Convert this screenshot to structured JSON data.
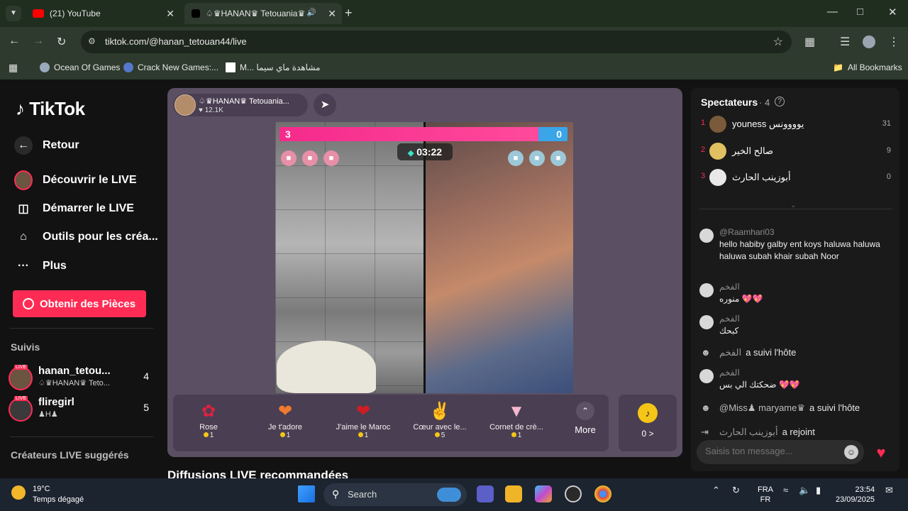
{
  "browser": {
    "tabs": [
      {
        "label": "(21) YouTube",
        "icon": "youtube-icon"
      },
      {
        "label": "♤♛HANAN♛ Tetouania♛",
        "icon": "tiktok-icon"
      }
    ],
    "url": "tiktok.com/@hanan_tetouan44/live",
    "bookmarks": [
      {
        "label": "Ocean Of Games"
      },
      {
        "label": "Crack New Games:..."
      },
      {
        "label": "M... مشاهدة ماي سيما"
      }
    ],
    "all_bookmarks": "All Bookmarks"
  },
  "sidebar": {
    "logo": "TikTok",
    "nav": [
      {
        "label": "Retour",
        "icon": "arrow-left-icon"
      },
      {
        "label": "Découvrir le LIVE",
        "icon": "live-avatar-icon"
      },
      {
        "label": "Démarrer le LIVE",
        "icon": "camera-icon"
      },
      {
        "label": "Outils pour les créa...",
        "icon": "house-tools-icon"
      },
      {
        "label": "Plus",
        "icon": "more-dots-icon"
      }
    ],
    "coins_button": "Obtenir des Pièces",
    "followed_title": "Suivis",
    "followed": [
      {
        "name": "hanan_tetou...",
        "sub": "♤♛HANAN♛ Teto...",
        "count": "4",
        "live_badge": "LIVE"
      },
      {
        "name": "fliregirl",
        "sub": "♟H♟",
        "count": "5",
        "live_badge": "LIVE"
      }
    ],
    "suggested_title": "Créateurs LIVE suggérés"
  },
  "live": {
    "host_name": "♤♛HANAN♛ Tetouania...",
    "host_likes": "12.1K",
    "score_left": "3",
    "score_right": "0",
    "score_fraction": 0.9,
    "timer": "03:22",
    "gifts": [
      {
        "name": "Rose",
        "price": "1",
        "icon": "rose-icon"
      },
      {
        "name": "Je t'adore",
        "price": "1",
        "icon": "heart-hug-icon"
      },
      {
        "name": "J'aime le Maroc",
        "price": "1",
        "icon": "morocco-heart-icon"
      },
      {
        "name": "Cœur avec le...",
        "price": "5",
        "icon": "finger-heart-icon"
      },
      {
        "name": "Cornet de crè...",
        "price": "1",
        "icon": "ice-cream-icon"
      }
    ],
    "more_label": "More",
    "balance": "0 >",
    "recommended_title": "Diffusions LIVE recommandées"
  },
  "chat": {
    "spectators_title": "Spectateurs",
    "spectators_count": "· 4",
    "viewers": [
      {
        "rank": "1",
        "name": "youness يوووونس",
        "score": "31",
        "avatar_color": "#7a5a3a"
      },
      {
        "rank": "2",
        "name": "صالح الخير",
        "score": "9",
        "avatar_color": "#e0c060"
      },
      {
        "rank": "3",
        "name": "أبوزينب الحارث",
        "score": "0",
        "avatar_color": "#e8e8e8"
      }
    ],
    "comments": [
      {
        "user": "@Raamhari03",
        "text": "hello habiby galby ent koys haluwa haluwa haluwa subah khair subah Noor"
      },
      {
        "user": "الفخم",
        "text": "منوره 💖💖"
      },
      {
        "user": "الفخم",
        "text": "كبحك"
      },
      {
        "user": "الفخم",
        "action": "a suivi l'hôte"
      },
      {
        "user": "الفخم",
        "text": "ضحكتك الي بس 💖💖"
      },
      {
        "user": "@Miss♟ maryame♛",
        "action": "a suivi l'hôte"
      },
      {
        "user": "أبوزينب الحارث",
        "action": "a rejoint"
      }
    ],
    "input_placeholder": "Saisis ton message..."
  },
  "taskbar": {
    "temperature": "19°C",
    "weather": "Temps dégagé",
    "search": "Search",
    "lang_top": "FRA",
    "lang_bottom": "FR",
    "time": "23:54",
    "date": "23/09/2025"
  },
  "colors": {
    "accent": "#fe2c55",
    "panel": "#5b4f63",
    "score_bar_left": "#f52a8c",
    "score_bar_right": "#3aa5e8"
  }
}
